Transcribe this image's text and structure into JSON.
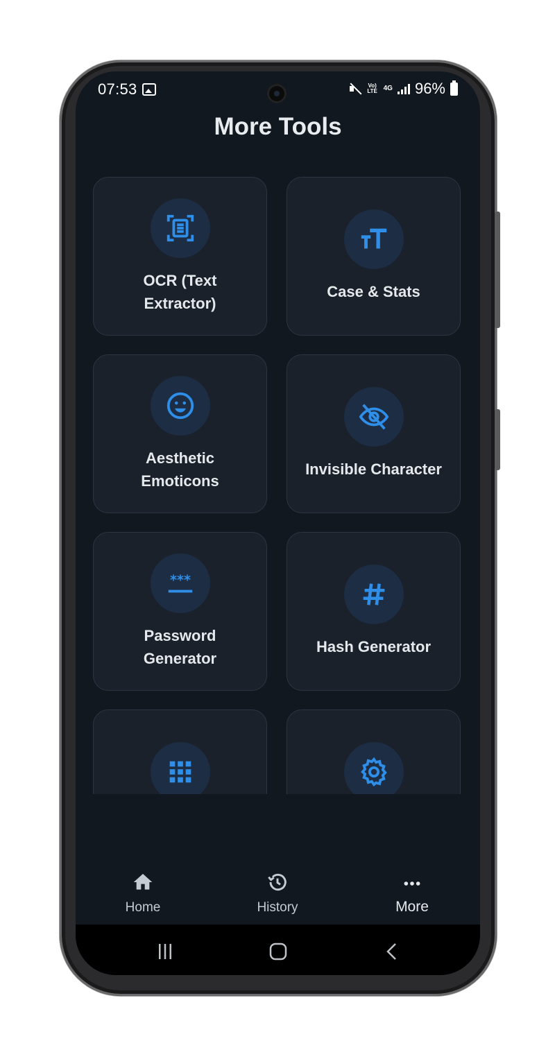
{
  "status_bar": {
    "time": "07:53",
    "network": "4G",
    "volte": "Vo) LTE",
    "battery": "96%"
  },
  "page": {
    "title": "More Tools"
  },
  "tools": [
    {
      "label_line1": "OCR (Text",
      "label_line2": "Extractor)",
      "icon": "document-scan-icon"
    },
    {
      "label_line1": "Case & Stats",
      "label_line2": "",
      "icon": "text-case-icon"
    },
    {
      "label_line1": "Aesthetic",
      "label_line2": "Emoticons",
      "icon": "smiley-icon"
    },
    {
      "label_line1": "Invisible Character",
      "label_line2": "",
      "icon": "eye-off-icon"
    },
    {
      "label_line1": "Password",
      "label_line2": "Generator",
      "icon": "password-icon"
    },
    {
      "label_line1": "Hash Generator",
      "label_line2": "",
      "icon": "hash-icon"
    },
    {
      "label_line1": "",
      "label_line2": "",
      "icon": "grid-icon"
    },
    {
      "label_line1": "",
      "label_line2": "",
      "icon": "gear-icon"
    }
  ],
  "bottom_nav": [
    {
      "label": "Home",
      "icon": "home-icon"
    },
    {
      "label": "History",
      "icon": "history-icon"
    },
    {
      "label": "More",
      "icon": "more-icon",
      "active": true
    }
  ],
  "colors": {
    "background": "#121820",
    "card": "#1a212b",
    "icon_circle": "#1c2d44",
    "accent": "#2e8ee8",
    "text": "#e6e9ec"
  }
}
